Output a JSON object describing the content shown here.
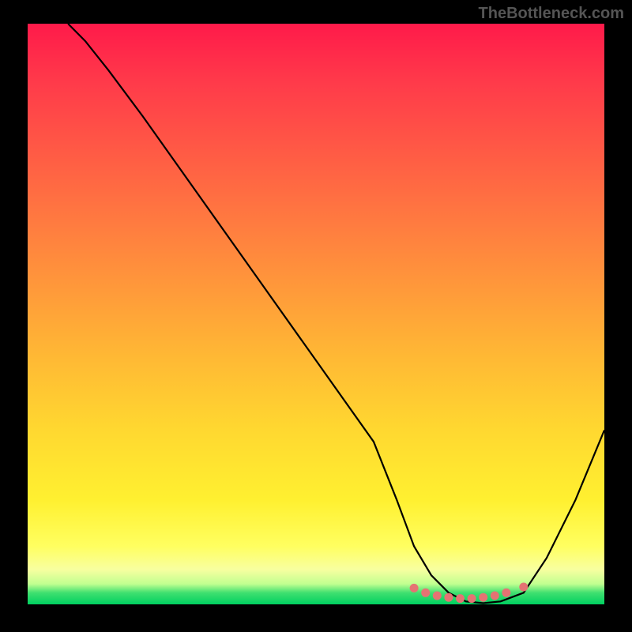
{
  "watermark": "TheBottleneck.com",
  "chart_data": {
    "type": "line",
    "title": "",
    "xlabel": "",
    "ylabel": "",
    "xlim": [
      0,
      100
    ],
    "ylim": [
      0,
      100
    ],
    "series": [
      {
        "name": "bottleneck-curve",
        "x": [
          7,
          10,
          14,
          20,
          30,
          40,
          50,
          60,
          64,
          67,
          70,
          73,
          76,
          79,
          82,
          86,
          90,
          95,
          100
        ],
        "y": [
          100,
          97,
          92,
          84,
          70,
          56,
          42,
          28,
          18,
          10,
          5,
          2,
          0.5,
          0.2,
          0.5,
          2,
          8,
          18,
          30
        ]
      }
    ],
    "markers": {
      "name": "optimal-zone",
      "x": [
        67,
        69,
        71,
        73,
        75,
        77,
        79,
        81,
        83,
        86
      ],
      "y": [
        2.8,
        2.0,
        1.5,
        1.2,
        1.0,
        1.0,
        1.2,
        1.5,
        2.0,
        3.0
      ]
    },
    "gradient_colors": {
      "top": "#ff1a4a",
      "mid_upper": "#ff9a3a",
      "mid": "#ffd830",
      "mid_lower": "#ffff60",
      "bottom": "#00d060"
    }
  }
}
